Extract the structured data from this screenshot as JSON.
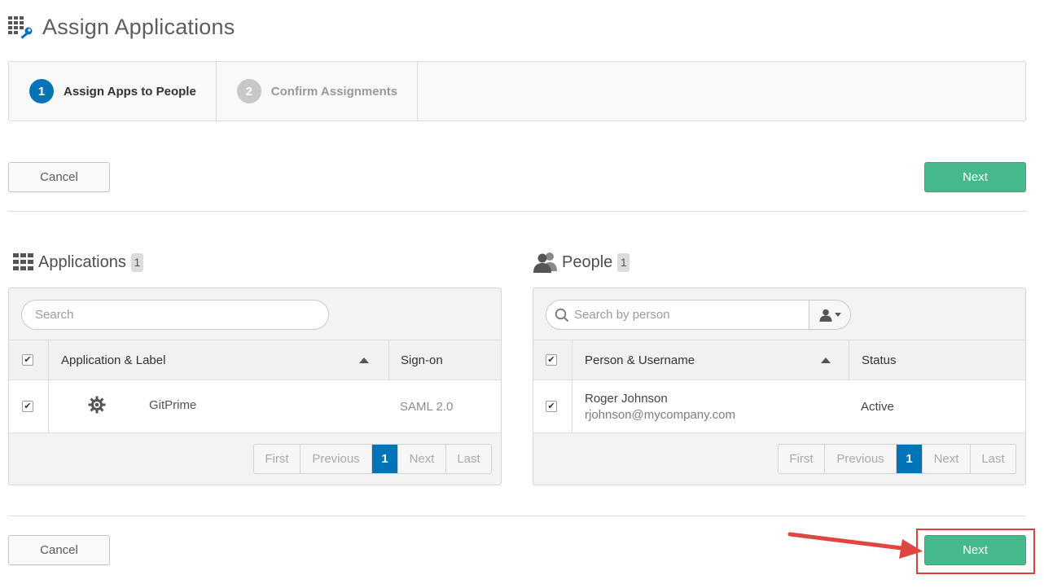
{
  "header": {
    "title": "Assign Applications",
    "icon": "apps-key-icon"
  },
  "wizard": {
    "steps": [
      {
        "number": "1",
        "label": "Assign Apps to People",
        "state": "active"
      },
      {
        "number": "2",
        "label": "Confirm Assignments",
        "state": "inactive"
      }
    ]
  },
  "actions": {
    "cancel_label": "Cancel",
    "next_label": "Next"
  },
  "applications": {
    "title": "Applications",
    "count": "1",
    "search_placeholder": "Search",
    "columns": {
      "name": "Application & Label",
      "signon": "Sign-on"
    },
    "rows": [
      {
        "name": "GitPrime",
        "signon": "SAML 2.0",
        "icon": "gear-icon",
        "checked": true
      }
    ],
    "pager": {
      "first": "First",
      "previous": "Previous",
      "page": "1",
      "next": "Next",
      "last": "Last"
    }
  },
  "people": {
    "title": "People",
    "count": "1",
    "search_placeholder": "Search by person",
    "columns": {
      "name": "Person & Username",
      "status": "Status"
    },
    "rows": [
      {
        "name": "Roger Johnson",
        "username": "rjohnson@mycompany.com",
        "status": "Active",
        "checked": true
      }
    ],
    "pager": {
      "first": "First",
      "previous": "Previous",
      "page": "1",
      "next": "Next",
      "last": "Last"
    }
  },
  "colors": {
    "primary_blue": "#0074b7",
    "next_green": "#46b98c",
    "annotation_red": "#d9413c"
  }
}
